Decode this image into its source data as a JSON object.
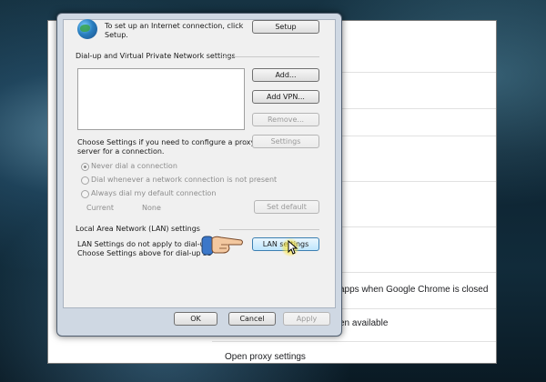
{
  "dialog": {
    "connection_text_line1": "To set up an Internet connection, click",
    "connection_text_line2": "Setup.",
    "setup_label": "Setup",
    "dialup_group": "Dial-up and Virtual Private Network settings",
    "add_label": "Add...",
    "add_vpn_label": "Add VPN...",
    "remove_label": "Remove...",
    "choose_text_line1": "Choose Settings if you need to configure a proxy",
    "choose_text_line2": "server for a connection.",
    "settings_label": "Settings",
    "radio_never": "Never dial a connection",
    "radio_whenever": "Dial whenever a network connection is not present",
    "radio_always": "Always dial my default connection",
    "current_label": "Current",
    "current_value": "None",
    "set_default_label": "Set default",
    "lan_group": "Local Area Network (LAN) settings",
    "lan_text_line1": "LAN Settings do not apply to dial-up",
    "lan_text_line2": "Choose Settings above for dial-up se",
    "lan_settings_label": "LAN settings",
    "ok_label": "OK",
    "cancel_label": "Cancel",
    "apply_label": "Apply"
  },
  "chrome": {
    "row_background_apps": "apps when Google Chrome is closed",
    "row_hardware": "en available",
    "row_proxy": "Open proxy settings"
  },
  "icons": {
    "globe": "globe-icon",
    "hand": "pointing-hand-icon",
    "cursor": "mouse-cursor-icon"
  },
  "colors": {
    "dialog_frame": "#cfd8e3",
    "button_hot": "#bee6fd",
    "highlight": "#ffe84a"
  }
}
